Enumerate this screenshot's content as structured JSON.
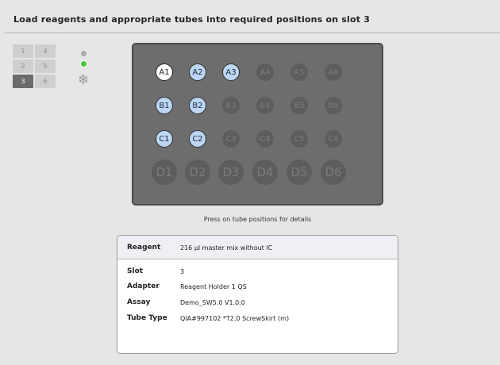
{
  "title": "Load reagents and appropriate tubes into required positions on slot 3",
  "slots": [
    "1",
    "4",
    "2",
    "5",
    "3",
    "6"
  ],
  "active_slot": "3",
  "status": {
    "indicator_1": "gray",
    "indicator_2": "green",
    "icon": "snowflake-icon"
  },
  "rack": {
    "rows": [
      [
        {
          "label": "A1",
          "state": "selected"
        },
        {
          "label": "A2",
          "state": "loaded"
        },
        {
          "label": "A3",
          "state": "loaded"
        },
        {
          "label": "A4",
          "state": "empty"
        },
        {
          "label": "A5",
          "state": "empty"
        },
        {
          "label": "A6",
          "state": "empty"
        }
      ],
      [
        {
          "label": "B1",
          "state": "loaded"
        },
        {
          "label": "B2",
          "state": "loaded"
        },
        {
          "label": "B3",
          "state": "empty"
        },
        {
          "label": "B4",
          "state": "empty"
        },
        {
          "label": "B5",
          "state": "empty"
        },
        {
          "label": "B6",
          "state": "empty"
        }
      ],
      [
        {
          "label": "C1",
          "state": "loaded"
        },
        {
          "label": "C2",
          "state": "loaded"
        },
        {
          "label": "C3",
          "state": "empty"
        },
        {
          "label": "C4",
          "state": "empty"
        },
        {
          "label": "C5",
          "state": "empty"
        },
        {
          "label": "C6",
          "state": "empty"
        }
      ],
      [
        {
          "label": "D1",
          "state": "empty"
        },
        {
          "label": "D2",
          "state": "empty"
        },
        {
          "label": "D3",
          "state": "empty"
        },
        {
          "label": "D4",
          "state": "empty"
        },
        {
          "label": "D5",
          "state": "empty"
        },
        {
          "label": "D6",
          "state": "empty"
        }
      ]
    ]
  },
  "hint": "Press on tube positions for details",
  "details": {
    "reagent_label": "Reagent",
    "reagent_value": "216 µl master mix without IC",
    "slot_label": "Slot",
    "slot_value": "3",
    "adapter_label": "Adapter",
    "adapter_value": "Reagent Holder 1 QS",
    "assay_label": "Assay",
    "assay_value": "Demo_SW5.0 V1.0.0",
    "tube_type_label": "Tube Type",
    "tube_type_value": "QIA#997102 *T2.0 ScrewSkirt  (m)"
  },
  "colors": {
    "loaded_tube": "#bcd6f3",
    "selected_tube": "#ffffff",
    "empty_tube": "#5d5d5d",
    "rack": "#6d6d6d",
    "active_slot": "#6b6b6b",
    "status_green": "#46c83a"
  }
}
